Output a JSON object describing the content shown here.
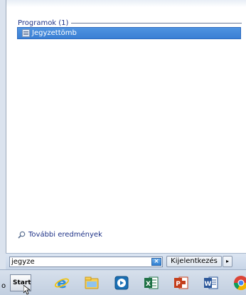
{
  "start_menu": {
    "group_header": "Programok (1)",
    "result_item": "Jegyzettömb",
    "more_results": "További eredmények",
    "search_value": "jegyze",
    "clear_button_glyph": "×",
    "logoff_label": "Kijelentkezés",
    "arrow_glyph": "▸"
  },
  "taskbar": {
    "start_label": "Start",
    "edge_text": "o",
    "icons": [
      "internet-explorer-icon",
      "file-explorer-icon",
      "media-player-icon",
      "excel-icon",
      "powerpoint-icon",
      "word-icon",
      "chrome-icon"
    ]
  },
  "colors": {
    "highlight": "#3a7fd4",
    "header_text": "#1e3287",
    "taskbar": "#c2cfe0"
  }
}
